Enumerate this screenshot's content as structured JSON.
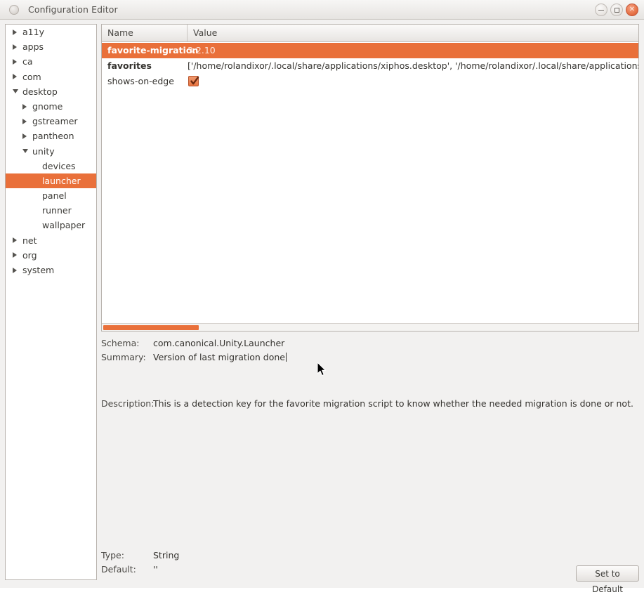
{
  "window": {
    "title": "Configuration Editor",
    "buttons": {
      "minimize": "−",
      "maximize": "□",
      "close": "×"
    }
  },
  "tree": {
    "items": [
      {
        "label": "a11y",
        "depth": 0,
        "arrow": "closed",
        "selected": false
      },
      {
        "label": "apps",
        "depth": 0,
        "arrow": "closed",
        "selected": false
      },
      {
        "label": "ca",
        "depth": 0,
        "arrow": "closed",
        "selected": false
      },
      {
        "label": "com",
        "depth": 0,
        "arrow": "closed",
        "selected": false
      },
      {
        "label": "desktop",
        "depth": 0,
        "arrow": "open",
        "selected": false
      },
      {
        "label": "gnome",
        "depth": 1,
        "arrow": "closed",
        "selected": false
      },
      {
        "label": "gstreamer",
        "depth": 1,
        "arrow": "closed",
        "selected": false
      },
      {
        "label": "pantheon",
        "depth": 1,
        "arrow": "closed",
        "selected": false
      },
      {
        "label": "unity",
        "depth": 1,
        "arrow": "open",
        "selected": false
      },
      {
        "label": "devices",
        "depth": 2,
        "arrow": "none",
        "selected": false
      },
      {
        "label": "launcher",
        "depth": 2,
        "arrow": "none",
        "selected": true
      },
      {
        "label": "panel",
        "depth": 2,
        "arrow": "none",
        "selected": false
      },
      {
        "label": "runner",
        "depth": 2,
        "arrow": "none",
        "selected": false
      },
      {
        "label": "wallpaper",
        "depth": 2,
        "arrow": "none",
        "selected": false
      },
      {
        "label": "net",
        "depth": 0,
        "arrow": "closed",
        "selected": false
      },
      {
        "label": "org",
        "depth": 0,
        "arrow": "closed",
        "selected": false
      },
      {
        "label": "system",
        "depth": 0,
        "arrow": "closed",
        "selected": false
      }
    ]
  },
  "list": {
    "columns": {
      "name": "Name",
      "value": "Value"
    },
    "rows": [
      {
        "name": "favorite-migration",
        "value": "3.2.10",
        "bold": true,
        "selected": true,
        "type": "text"
      },
      {
        "name": "favorites",
        "value": "['/home/rolandixor/.local/share/applications/xiphos.desktop', '/home/rolandixor/.local/share/applications/nautilus-ho",
        "bold": true,
        "selected": false,
        "type": "text"
      },
      {
        "name": "shows-on-edge",
        "value": "",
        "bold": false,
        "selected": false,
        "type": "checkbox",
        "checked": true
      }
    ]
  },
  "detail": {
    "schema_label": "Schema:",
    "schema_value": "com.canonical.Unity.Launcher",
    "summary_label": "Summary:",
    "summary_value": "Version of last migration done",
    "description_label": "Description:",
    "description_value": "This is a detection key for the favorite migration script to know whether the needed migration is done or not.",
    "type_label": "Type:",
    "type_value": "String",
    "default_label": "Default:",
    "default_value": "''",
    "set_to_default_button": "Set to Default"
  },
  "colors": {
    "accent": "#e9703a",
    "window_bg": "#f2f1f0",
    "panel_bg": "#ffffff",
    "text": "#35332f"
  }
}
